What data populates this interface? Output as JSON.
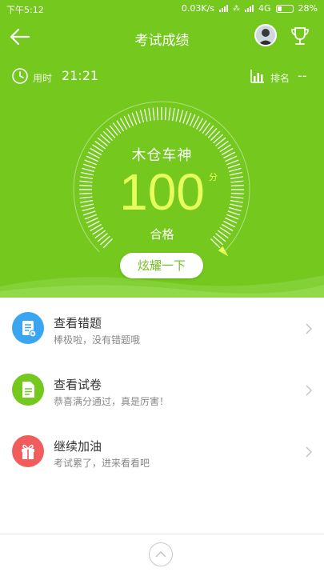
{
  "status_bar": {
    "time": "下午5:12",
    "network_speed": "0.03K/s",
    "network_type": "4G",
    "battery": "28%"
  },
  "header": {
    "title": "考试成绩"
  },
  "stats": {
    "time_used_label": "用时",
    "time_used_value": "21:21",
    "rank_label": "排名",
    "rank_value": "--"
  },
  "result": {
    "nickname": "木仓车神",
    "score": "100",
    "score_unit": "分",
    "status": "合格",
    "share_label": "炫耀一下",
    "score_fraction": 1.0
  },
  "menu": {
    "items": [
      {
        "title": "查看错题",
        "subtitle": "棒极啦，没有错题哦",
        "icon": "mistakes-doc-icon",
        "color": "#3aa6f2"
      },
      {
        "title": "查看试卷",
        "subtitle": "恭喜满分通过，真是厉害！",
        "icon": "paper-doc-icon",
        "color": "#74c81e"
      },
      {
        "title": "继续加油",
        "subtitle": "考试累了，进来看看吧",
        "icon": "gift-icon",
        "color": "#f15c5c"
      }
    ]
  },
  "colors": {
    "hero_green": "#74c81e",
    "score_yellow": "#e6ff5c",
    "blue": "#3aa6f2",
    "red": "#f15c5c"
  }
}
